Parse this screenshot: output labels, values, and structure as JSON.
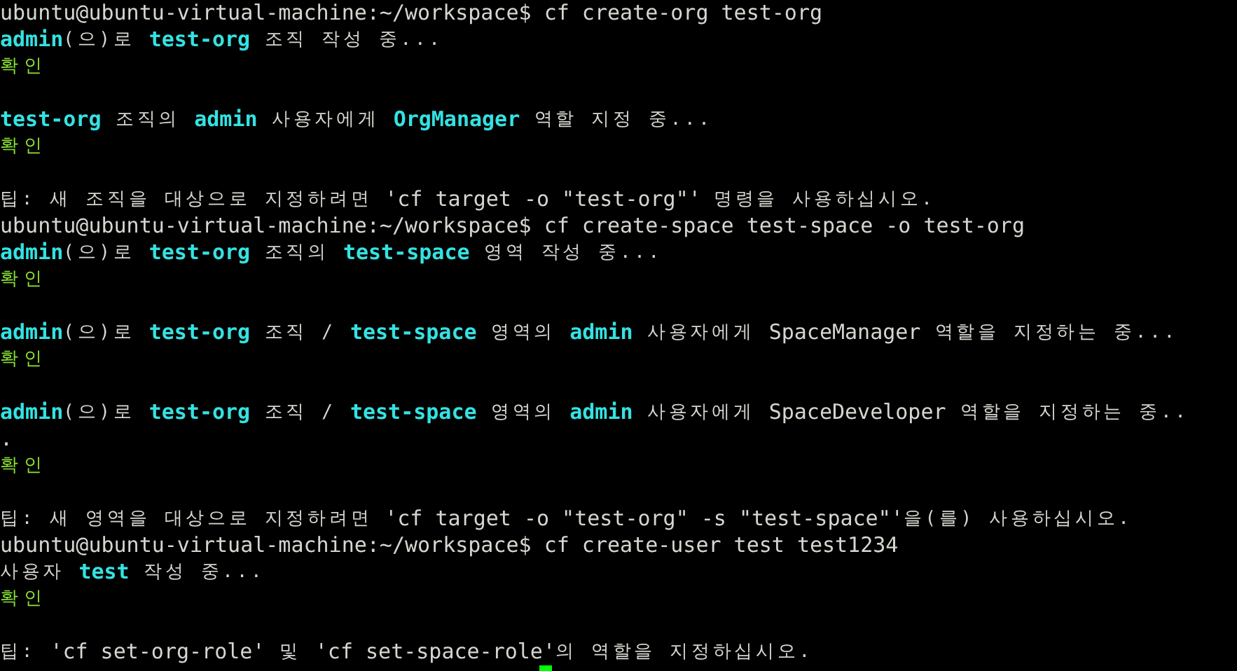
{
  "terminal": {
    "lines": [
      {
        "kind": "text",
        "segments": [
          {
            "kind": "plain",
            "text": "ubuntu@ubuntu-virtual-machine:~/workspace$ cf create-org test-org"
          }
        ]
      },
      {
        "kind": "text",
        "segments": [
          {
            "kind": "hl",
            "text": "admin"
          },
          {
            "kind": "ko",
            "text": "(으)로 "
          },
          {
            "kind": "hl",
            "text": "test-org"
          },
          {
            "kind": "ko",
            "text": " 조직 작성 중..."
          }
        ]
      },
      {
        "kind": "text",
        "segments": [
          {
            "kind": "ok",
            "text": "확인"
          }
        ]
      },
      {
        "kind": "blank"
      },
      {
        "kind": "text",
        "segments": [
          {
            "kind": "hl",
            "text": "test-org"
          },
          {
            "kind": "ko",
            "text": " 조직의 "
          },
          {
            "kind": "hl",
            "text": "admin"
          },
          {
            "kind": "ko",
            "text": " 사용자에게 "
          },
          {
            "kind": "hl",
            "text": "OrgManager"
          },
          {
            "kind": "ko",
            "text": " 역할 지정 중..."
          }
        ]
      },
      {
        "kind": "text",
        "segments": [
          {
            "kind": "ok",
            "text": "확인"
          }
        ]
      },
      {
        "kind": "blank"
      },
      {
        "kind": "text",
        "segments": [
          {
            "kind": "ko",
            "text": "팁: 새 조직을 대상으로 지정하려면"
          },
          {
            "kind": "plain",
            "text": " 'cf target -o \"test-org\"' "
          },
          {
            "kind": "ko",
            "text": "명령을 사용하십시오."
          }
        ]
      },
      {
        "kind": "text",
        "segments": [
          {
            "kind": "plain",
            "text": "ubuntu@ubuntu-virtual-machine:~/workspace$ cf create-space test-space -o test-org"
          }
        ]
      },
      {
        "kind": "text",
        "segments": [
          {
            "kind": "hl",
            "text": "admin"
          },
          {
            "kind": "ko",
            "text": "(으)로 "
          },
          {
            "kind": "hl",
            "text": "test-org"
          },
          {
            "kind": "ko",
            "text": " 조직의 "
          },
          {
            "kind": "hl",
            "text": "test-space"
          },
          {
            "kind": "ko",
            "text": " 영역 작성 중..."
          }
        ]
      },
      {
        "kind": "text",
        "segments": [
          {
            "kind": "ok",
            "text": "확인"
          }
        ]
      },
      {
        "kind": "blank"
      },
      {
        "kind": "text",
        "segments": [
          {
            "kind": "hl",
            "text": "admin"
          },
          {
            "kind": "ko",
            "text": "(으)로 "
          },
          {
            "kind": "hl",
            "text": "test-org"
          },
          {
            "kind": "ko",
            "text": " 조직 / "
          },
          {
            "kind": "hl",
            "text": "test-space"
          },
          {
            "kind": "ko",
            "text": " 영역의 "
          },
          {
            "kind": "hl",
            "text": "admin"
          },
          {
            "kind": "ko",
            "text": " 사용자에게 "
          },
          {
            "kind": "plain",
            "text": "SpaceManager"
          },
          {
            "kind": "ko",
            "text": " 역할을 지정하는 중..."
          }
        ]
      },
      {
        "kind": "text",
        "segments": [
          {
            "kind": "ok",
            "text": "확인"
          }
        ]
      },
      {
        "kind": "blank"
      },
      {
        "kind": "text",
        "segments": [
          {
            "kind": "hl",
            "text": "admin"
          },
          {
            "kind": "ko",
            "text": "(으)로 "
          },
          {
            "kind": "hl",
            "text": "test-org"
          },
          {
            "kind": "ko",
            "text": " 조직 / "
          },
          {
            "kind": "hl",
            "text": "test-space"
          },
          {
            "kind": "ko",
            "text": " 영역의 "
          },
          {
            "kind": "hl",
            "text": "admin"
          },
          {
            "kind": "ko",
            "text": " 사용자에게 "
          },
          {
            "kind": "plain",
            "text": "SpaceDeveloper"
          },
          {
            "kind": "ko",
            "text": " 역할을 지정하는 중.."
          }
        ]
      },
      {
        "kind": "text",
        "segments": [
          {
            "kind": "plain",
            "text": "."
          }
        ]
      },
      {
        "kind": "text",
        "segments": [
          {
            "kind": "ok",
            "text": "확인"
          }
        ]
      },
      {
        "kind": "blank"
      },
      {
        "kind": "text",
        "segments": [
          {
            "kind": "ko",
            "text": "팁: 새 영역을 대상으로 지정하려면"
          },
          {
            "kind": "plain",
            "text": " 'cf target -o \"test-org\" -s \"test-space\"'"
          },
          {
            "kind": "ko",
            "text": "을(를) 사용하십시오."
          }
        ]
      },
      {
        "kind": "text",
        "segments": [
          {
            "kind": "plain",
            "text": "ubuntu@ubuntu-virtual-machine:~/workspace$ cf create-user test test1234"
          }
        ]
      },
      {
        "kind": "text",
        "segments": [
          {
            "kind": "ko",
            "text": "사용자 "
          },
          {
            "kind": "hl",
            "text": "test"
          },
          {
            "kind": "ko",
            "text": " 작성 중..."
          }
        ]
      },
      {
        "kind": "text",
        "segments": [
          {
            "kind": "ok",
            "text": "확인"
          }
        ]
      },
      {
        "kind": "blank"
      },
      {
        "kind": "text",
        "segments": [
          {
            "kind": "ko",
            "text": "팁: "
          },
          {
            "kind": "plain",
            "text": "'cf set-org-role'"
          },
          {
            "kind": "ko",
            "text": " 및 "
          },
          {
            "kind": "plain",
            "text": "'cf set-space-role'"
          },
          {
            "kind": "ko",
            "text": "의 역할을 지정하십시오."
          }
        ]
      },
      {
        "kind": "cursor"
      }
    ]
  }
}
